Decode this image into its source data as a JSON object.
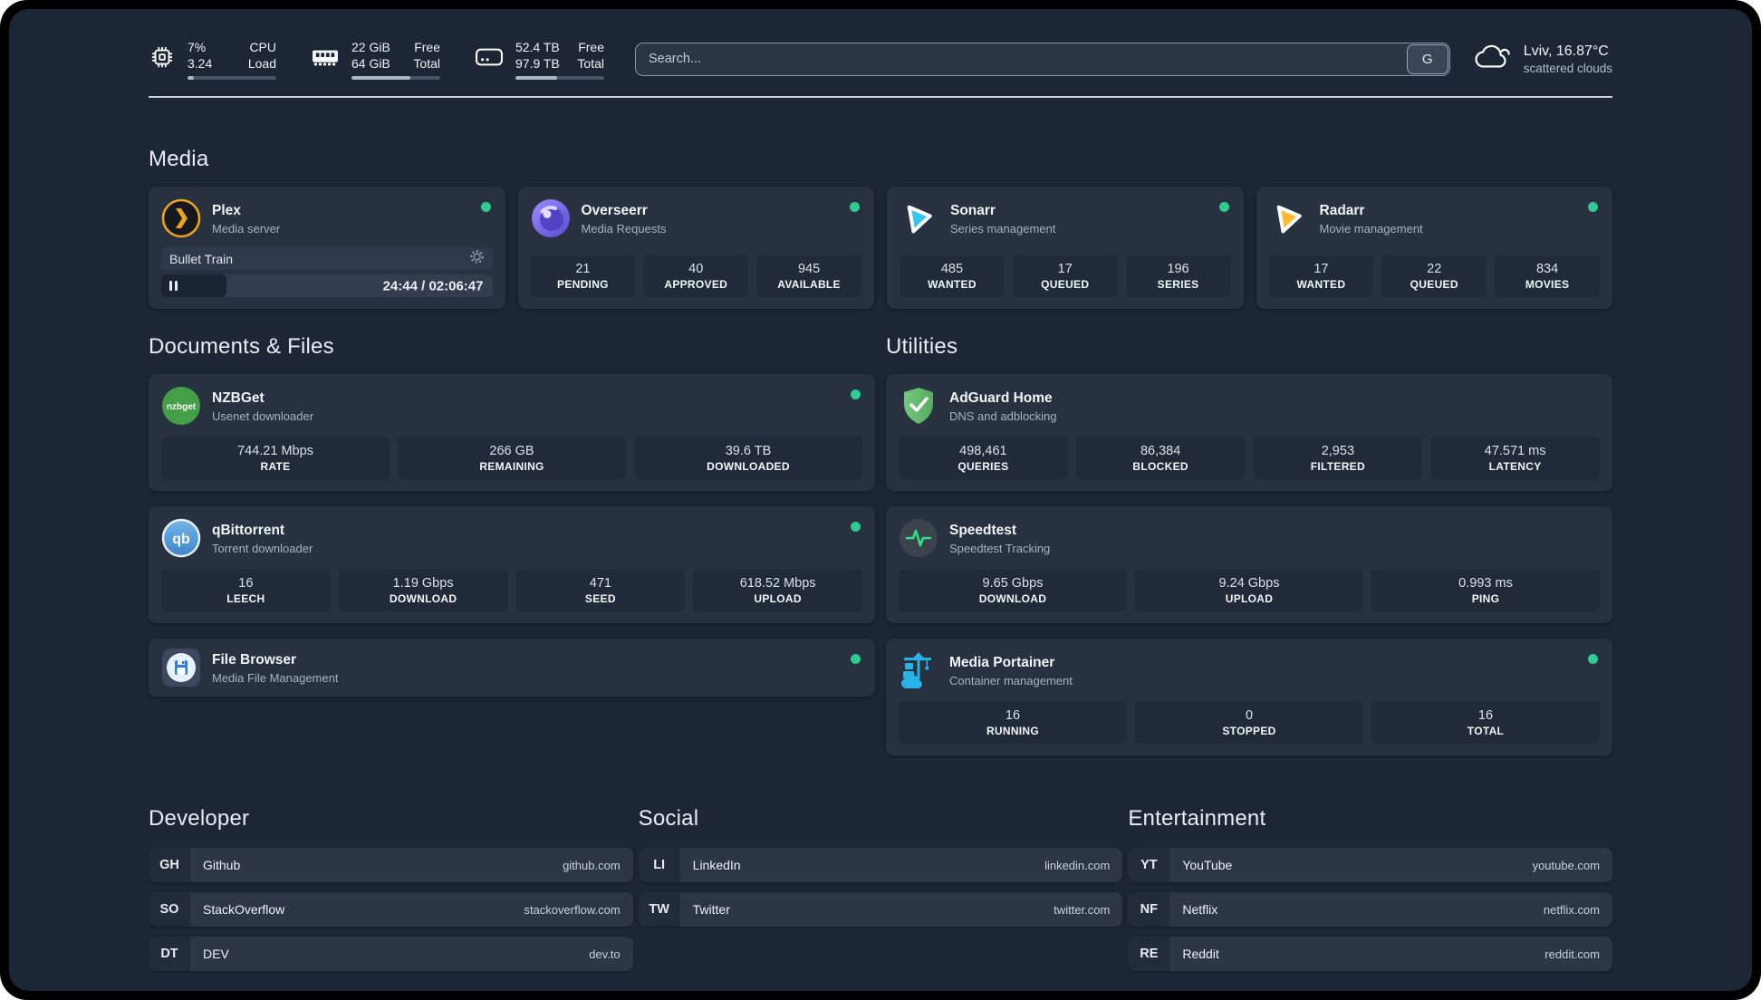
{
  "topbar": {
    "metrics": [
      {
        "icon": "cpu-icon",
        "value_top": "7%",
        "value_bottom": "3.24",
        "label_top": "CPU",
        "label_bottom": "Load",
        "progress_percent": 7
      },
      {
        "icon": "memory-icon",
        "value_top": "22 GiB",
        "value_bottom": "64 GiB",
        "label_top": "Free",
        "label_bottom": "Total",
        "progress_percent": 66
      },
      {
        "icon": "storage-icon",
        "value_top": "52.4 TB",
        "value_bottom": "97.9 TB",
        "label_top": "Free",
        "label_bottom": "Total",
        "progress_percent": 47
      }
    ],
    "search": {
      "placeholder": "Search...",
      "engine_button": "G"
    },
    "weather": {
      "location_temperature": "Lviv, 16.87°C",
      "condition": "scattered clouds"
    }
  },
  "media": {
    "title": "Media",
    "plex": {
      "name": "Plex",
      "description": "Media server",
      "status": "online",
      "now_playing": {
        "title": "Bullet Train",
        "time": "24:44 / 02:06:47",
        "progress_percent": 19.6
      }
    },
    "overseerr": {
      "name": "Overseerr",
      "description": "Media Requests",
      "status": "online",
      "stats": [
        {
          "value": "21",
          "label": "PENDING"
        },
        {
          "value": "40",
          "label": "APPROVED"
        },
        {
          "value": "945",
          "label": "AVAILABLE"
        }
      ]
    },
    "sonarr": {
      "name": "Sonarr",
      "description": "Series management",
      "status": "online",
      "stats": [
        {
          "value": "485",
          "label": "WANTED"
        },
        {
          "value": "17",
          "label": "QUEUED"
        },
        {
          "value": "196",
          "label": "SERIES"
        }
      ]
    },
    "radarr": {
      "name": "Radarr",
      "description": "Movie management",
      "status": "online",
      "stats": [
        {
          "value": "17",
          "label": "WANTED"
        },
        {
          "value": "22",
          "label": "QUEUED"
        },
        {
          "value": "834",
          "label": "MOVIES"
        }
      ]
    }
  },
  "documents": {
    "title": "Documents & Files",
    "nzbget": {
      "name": "NZBGet",
      "description": "Usenet downloader",
      "status": "online",
      "icon_text": "nzbget",
      "stats": [
        {
          "value": "744.21 Mbps",
          "label": "RATE"
        },
        {
          "value": "266 GB",
          "label": "REMAINING"
        },
        {
          "value": "39.6 TB",
          "label": "DOWNLOADED"
        }
      ]
    },
    "qbittorrent": {
      "name": "qBittorrent",
      "description": "Torrent downloader",
      "status": "online",
      "icon_text": "qb",
      "stats": [
        {
          "value": "16",
          "label": "LEECH"
        },
        {
          "value": "1.19 Gbps",
          "label": "DOWNLOAD"
        },
        {
          "value": "471",
          "label": "SEED"
        },
        {
          "value": "618.52 Mbps",
          "label": "UPLOAD"
        }
      ]
    },
    "filebrowser": {
      "name": "File Browser",
      "description": "Media File Management",
      "status": "online"
    }
  },
  "utilities": {
    "title": "Utilities",
    "adguard": {
      "name": "AdGuard Home",
      "description": "DNS and adblocking",
      "stats": [
        {
          "value": "498,461",
          "label": "QUERIES"
        },
        {
          "value": "86,384",
          "label": "BLOCKED"
        },
        {
          "value": "2,953",
          "label": "FILTERED"
        },
        {
          "value": "47.571 ms",
          "label": "LATENCY"
        }
      ]
    },
    "speedtest": {
      "name": "Speedtest",
      "description": "Speedtest Tracking",
      "stats": [
        {
          "value": "9.65 Gbps",
          "label": "DOWNLOAD"
        },
        {
          "value": "9.24 Gbps",
          "label": "UPLOAD"
        },
        {
          "value": "0.993 ms",
          "label": "PING"
        }
      ]
    },
    "portainer": {
      "name": "Media Portainer",
      "description": "Container management",
      "status": "online",
      "stats": [
        {
          "value": "16",
          "label": "RUNNING"
        },
        {
          "value": "0",
          "label": "STOPPED"
        },
        {
          "value": "16",
          "label": "TOTAL"
        }
      ]
    }
  },
  "bookmarks": [
    {
      "title": "Developer",
      "links": [
        {
          "abbr": "GH",
          "name": "Github",
          "url": "github.com"
        },
        {
          "abbr": "SO",
          "name": "StackOverflow",
          "url": "stackoverflow.com"
        },
        {
          "abbr": "DT",
          "name": "DEV",
          "url": "dev.to"
        }
      ]
    },
    {
      "title": "Social",
      "links": [
        {
          "abbr": "LI",
          "name": "LinkedIn",
          "url": "linkedin.com"
        },
        {
          "abbr": "TW",
          "name": "Twitter",
          "url": "twitter.com"
        }
      ]
    },
    {
      "title": "Entertainment",
      "links": [
        {
          "abbr": "YT",
          "name": "YouTube",
          "url": "youtube.com"
        },
        {
          "abbr": "NF",
          "name": "Netflix",
          "url": "netflix.com"
        },
        {
          "abbr": "RE",
          "name": "Reddit",
          "url": "reddit.com"
        }
      ]
    }
  ],
  "colors": {
    "status_online": "#2ecc8f",
    "panel_background": "#1d2634",
    "card_background": "#28313f",
    "plex_accent": "#eda41c",
    "sonarr_accent": "#35c5f4",
    "radarr_accent": "#ffb933",
    "overseerr_accent": "#7b6cf0",
    "qbittorrent_accent": "#4f9fe0",
    "nzbget_accent": "#43a047",
    "adguard_accent": "#68bc71",
    "speedtest_accent": "#2ee08a",
    "portainer_accent": "#29b2e8",
    "filebrowser_accent": "#2d7dd2"
  }
}
